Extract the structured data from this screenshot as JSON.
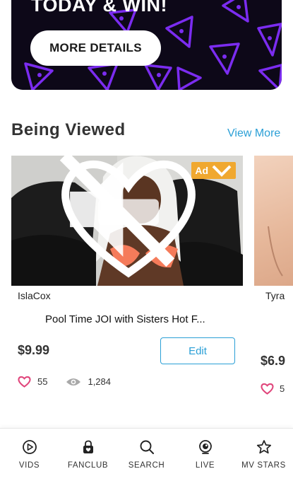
{
  "promo": {
    "title": "TODAY & WIN!",
    "button_label": "MORE DETAILS"
  },
  "section": {
    "title": "Being Viewed",
    "view_more_label": "View More"
  },
  "cards": [
    {
      "ad_label": "Ad",
      "creator": "IslaCox",
      "title": "Pool Time JOI with Sisters Hot F...",
      "price": "$9.99",
      "edit_label": "Edit",
      "likes": "55",
      "views": "1,284"
    },
    {
      "creator": "Tyra",
      "price": "$6.9",
      "likes": "5"
    }
  ],
  "nav": {
    "items": [
      {
        "label": "VIDS",
        "icon": "play-circle-icon"
      },
      {
        "label": "FANCLUB",
        "icon": "lock-heart-icon"
      },
      {
        "label": "SEARCH",
        "icon": "search-icon"
      },
      {
        "label": "LIVE",
        "icon": "live-icon"
      },
      {
        "label": "MV STARS",
        "icon": "star-icon"
      }
    ]
  },
  "colors": {
    "accent_blue": "#2a9fd6",
    "heart_pink": "#e0457b",
    "ad_orange": "#f0a830",
    "banner_bg": "#0d0818",
    "pizza_purple": "#7b2cf0"
  }
}
